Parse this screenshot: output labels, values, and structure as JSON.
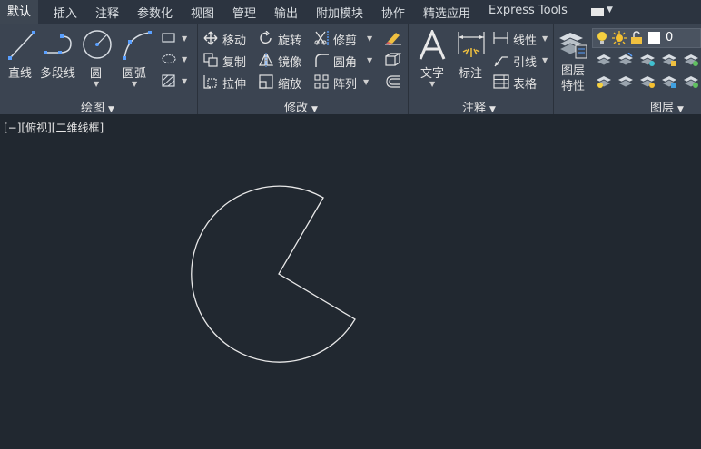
{
  "tabs": [
    "默认",
    "插入",
    "注释",
    "参数化",
    "视图",
    "管理",
    "输出",
    "附加模块",
    "协作",
    "精选应用",
    "Express Tools"
  ],
  "draw_panel": {
    "line": "直线",
    "polyline": "多段线",
    "circle": "圆",
    "arc": "圆弧",
    "title": "绘图"
  },
  "modify_panel": {
    "move": "移动",
    "rotate": "旋转",
    "trim": "修剪",
    "copy": "复制",
    "mirror": "镜像",
    "fillet": "圆角",
    "stretch": "拉伸",
    "scale": "缩放",
    "array": "阵列",
    "title": "修改"
  },
  "annotation_panel": {
    "text": "文字",
    "dimension": "标注",
    "linear": "线性",
    "leader": "引线",
    "table": "表格",
    "title": "注释"
  },
  "layers_panel": {
    "layer_properties": "图层特性",
    "current_layer": "0",
    "title": "图层"
  },
  "viewport": {
    "label": "[−][俯视][二维线框]"
  },
  "colors": {
    "canvas": "#212830",
    "ribbon": "#3b4451",
    "accent": "#5aa0ff"
  }
}
